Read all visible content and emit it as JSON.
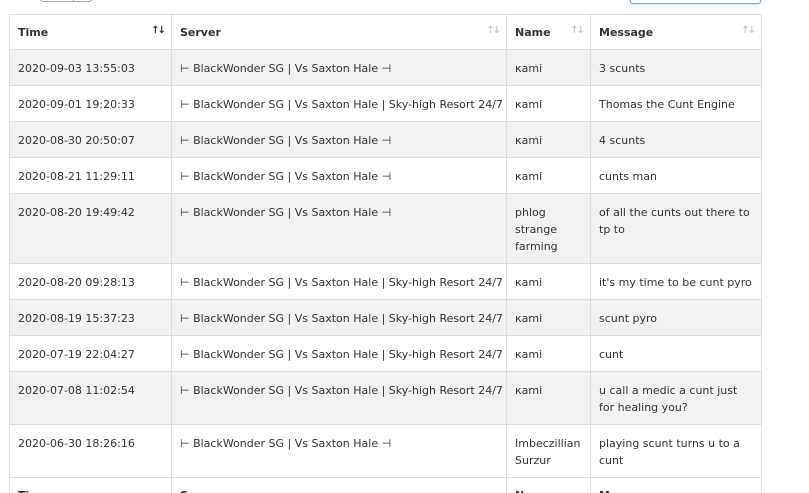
{
  "controls": {
    "search_value": ""
  },
  "table": {
    "columns": [
      "Time",
      "Server",
      "Name",
      "Message"
    ],
    "sort_icons": [
      "↑↓",
      "↑↓",
      "↑↓",
      "↑↓"
    ],
    "rows": [
      {
        "time": "2020-09-03 13:55:03",
        "server": "⊢ BlackWonder SG | Vs Saxton Hale ⊣",
        "name": "кami",
        "message": "3 scunts"
      },
      {
        "time": "2020-09-01 19:20:33",
        "server": "⊢ BlackWonder SG | Vs Saxton Hale | Sky-high Resort 24/7",
        "name": "кami",
        "message": "Thomas the Cunt Engine"
      },
      {
        "time": "2020-08-30 20:50:07",
        "server": "⊢ BlackWonder SG | Vs Saxton Hale ⊣",
        "name": "кami",
        "message": "4 scunts"
      },
      {
        "time": "2020-08-21 11:29:11",
        "server": "⊢ BlackWonder SG | Vs Saxton Hale ⊣",
        "name": "кami",
        "message": "cunts man"
      },
      {
        "time": "2020-08-20 19:49:42",
        "server": "⊢ BlackWonder SG | Vs Saxton Hale ⊣",
        "name": "phlog strange farming",
        "message": "of all the cunts out there to tp to"
      },
      {
        "time": "2020-08-20 09:28:13",
        "server": "⊢ BlackWonder SG | Vs Saxton Hale | Sky-high Resort 24/7",
        "name": "кami",
        "message": "it's my time to be cunt pyro"
      },
      {
        "time": "2020-08-19 15:37:23",
        "server": "⊢ BlackWonder SG | Vs Saxton Hale | Sky-high Resort 24/7",
        "name": "кami",
        "message": "scunt pyro"
      },
      {
        "time": "2020-07-19 22:04:27",
        "server": "⊢ BlackWonder SG | Vs Saxton Hale | Sky-high Resort 24/7",
        "name": "кami",
        "message": "cunt"
      },
      {
        "time": "2020-07-08 11:02:54",
        "server": "⊢ BlackWonder SG | Vs Saxton Hale | Sky-high Resort 24/7",
        "name": "кami",
        "message": "u call a medic a cunt just for healing you?"
      },
      {
        "time": "2020-06-30 18:26:16",
        "server": "⊢ BlackWonder SG | Vs Saxton Hale ⊣",
        "name": "Imbeczillian Surzur",
        "message": "playing scunt turns u to a cunt"
      }
    ]
  }
}
